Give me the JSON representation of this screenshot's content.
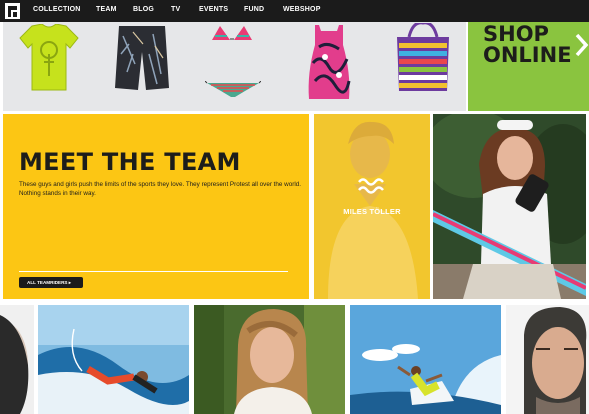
{
  "nav": {
    "logo_icon": "protest-logo-icon",
    "items": [
      "COLLECTION",
      "TEAM",
      "BLOG",
      "TV",
      "EVENTS",
      "FUND",
      "WEBSHOP"
    ]
  },
  "shop": {
    "products": [
      "lime-tshirt",
      "black-boardshorts",
      "bikini-top",
      "bikini-bottom",
      "pink-print-dress",
      "striped-tote-bag"
    ],
    "banner_line1": "SHOP",
    "banner_line2": "ONLINE",
    "arrow_icon": "chevron-right-icon"
  },
  "team": {
    "title": "MEET THE TEAM",
    "description": "These guys and girls push the limits of the sports they love. They represent Protest all over the world. Nothing stands in their way.",
    "button_label": "ALL TEAMRIDERS",
    "button_icon": "chevron-right-icon"
  },
  "featured_rider": {
    "name": "MILES TÖLLER",
    "logo_icon": "wave-logo-icon"
  },
  "photos": [
    "rider-kiteboarder-photo",
    "rider-partial-portrait-photo",
    "rider-surfing-action-photo",
    "rider-woman-portrait-photo",
    "rider-surfing-wave-photo",
    "rider-man-portrait-photo"
  ],
  "colors": {
    "nav_bg": "#1b1b1b",
    "shop_green": "#8ac43f",
    "team_yellow": "#fcc614",
    "product_bg": "#e6e7e9"
  }
}
